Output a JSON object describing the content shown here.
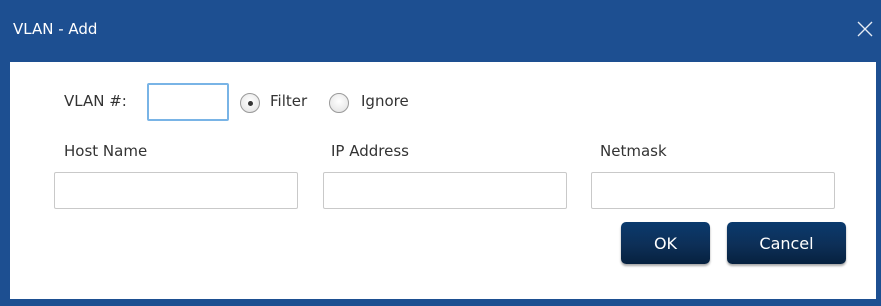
{
  "dialog": {
    "title": "VLAN - Add",
    "close_icon": "close-icon",
    "accent_color": "#1d4f91"
  },
  "vlan": {
    "label": "VLAN #:",
    "value": "",
    "mode_options": [
      {
        "label": "Filter",
        "selected": true
      },
      {
        "label": "Ignore",
        "selected": false
      }
    ]
  },
  "fields": [
    {
      "label": "Host Name",
      "value": ""
    },
    {
      "label": "IP Address",
      "value": ""
    },
    {
      "label": "Netmask",
      "value": ""
    }
  ],
  "buttons": {
    "ok_label": "OK",
    "cancel_label": "Cancel"
  }
}
